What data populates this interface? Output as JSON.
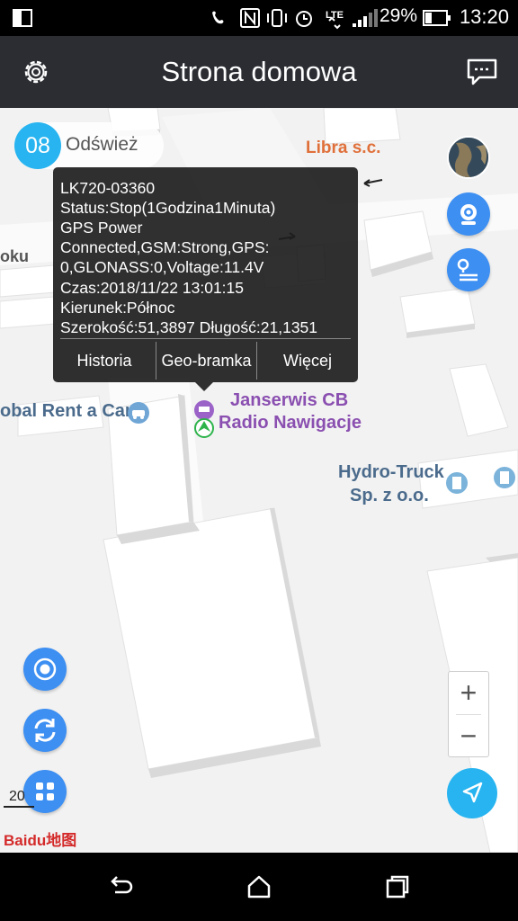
{
  "status_bar": {
    "battery_percent": "29%",
    "time": "13:20",
    "network": "LTE"
  },
  "app_bar": {
    "title": "Strona domowa",
    "left_icon": "gear-icon",
    "right_icon": "message-icon"
  },
  "refresh": {
    "count": "08",
    "label": "Odśwież"
  },
  "map": {
    "pois": {
      "libra": "Libra s.c.",
      "rent": "obal Rent a Car",
      "janserwis_1": "Janserwis CB",
      "janserwis_2": "Radio Nawigacje",
      "hydro_1": "Hydro-Truck",
      "hydro_2": "Sp. z o.o."
    },
    "street_fragment": "oku",
    "scale_text": "20",
    "logo_text": "Baidu地图"
  },
  "popup": {
    "lines": [
      "LK720-03360",
      "Status:Stop(1Godzina1Minuta)",
      "GPS Power",
      "Connected,GSM:Strong,GPS:",
      "0,GLONASS:0,Voltage:11.4V",
      "Czas:2018/11/22 13:01:15",
      "Kierunek:Północ",
      "Szerokość:51,3897  Długość:21,1351"
    ],
    "buttons": {
      "history": "Historia",
      "geofence": "Geo-bramka",
      "more": "Więcej"
    }
  },
  "zoom": {
    "plus": "+",
    "minus": "−"
  },
  "colors": {
    "accent": "#27b4f0",
    "button_blue": "#3d8ff2",
    "app_bar": "#2b2d33",
    "map_bg": "#f2f2f2"
  },
  "icons": {
    "map_buttons_right": [
      "satellite-thumbnail-icon",
      "camera-icon",
      "route-icon"
    ],
    "map_buttons_left": [
      "locate-icon",
      "refresh-cycle-icon",
      "grid-menu-icon"
    ],
    "navigation": [
      "back-icon",
      "home-icon",
      "recents-icon"
    ]
  }
}
